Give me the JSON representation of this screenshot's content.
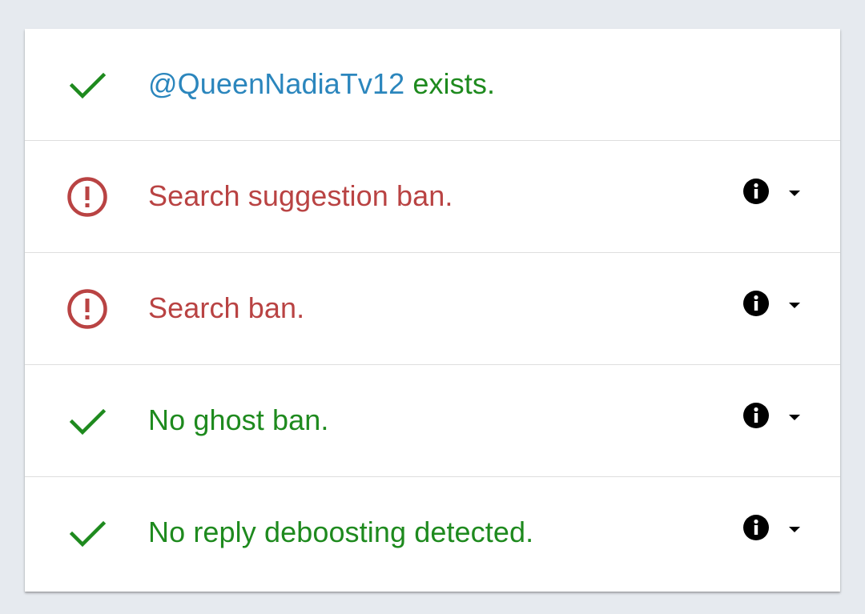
{
  "colors": {
    "ok": "#1e8a1e",
    "bad": "#b94343",
    "handle": "#2b86bd",
    "background": "#e6eaef"
  },
  "rows": [
    {
      "status": "ok",
      "icon": "checkmark-icon",
      "handle": "@QueenNadiaTv12",
      "text": " exists.",
      "has_info": false
    },
    {
      "status": "bad",
      "icon": "exclamation-circle-icon",
      "text": "Search suggestion ban.",
      "has_info": true
    },
    {
      "status": "bad",
      "icon": "exclamation-circle-icon",
      "text": "Search ban.",
      "has_info": true
    },
    {
      "status": "ok",
      "icon": "checkmark-icon",
      "text": "No ghost ban.",
      "has_info": true
    },
    {
      "status": "ok",
      "icon": "checkmark-icon",
      "text": "No reply deboosting detected.",
      "has_info": true
    }
  ]
}
